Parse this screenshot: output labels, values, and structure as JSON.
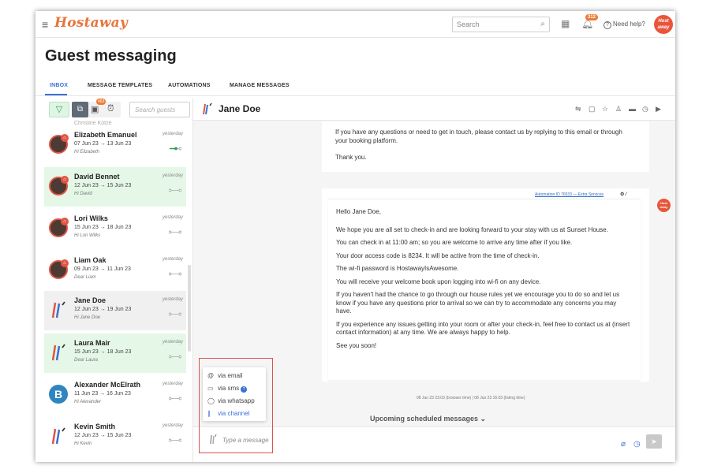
{
  "topbar": {
    "brand": "Hostaway",
    "search_placeholder": "Search",
    "notification_count": "312",
    "help_label": "Need help?",
    "user_avatar_text": "Host away"
  },
  "page": {
    "title": "Guest messaging"
  },
  "tabs": [
    {
      "label": "INBOX",
      "active": true
    },
    {
      "label": "MESSAGE TEMPLATES",
      "active": false
    },
    {
      "label": "AUTOMATIONS",
      "active": false
    },
    {
      "label": "MANAGE MESSAGES",
      "active": false
    }
  ],
  "left_panel": {
    "archive_badge": "463",
    "search_placeholder": "Search guests",
    "cut_off_text": "Christine Kotze",
    "conversations": [
      {
        "name": "Elizabeth Emanuel",
        "dates": "07 Jun 23 → 13 Jun 23",
        "message": "Hi Elizabeth",
        "when": "yesterday",
        "progress": 0.6,
        "background": "white",
        "channel": "airbnb"
      },
      {
        "name": "David Bennet",
        "dates": "12 Jun 23 → 15 Jun 23",
        "message": "Hi David",
        "when": "yesterday",
        "progress": 0,
        "background": "green",
        "channel": "airbnb"
      },
      {
        "name": "Lori Wilks",
        "dates": "15 Jun 23 → 18 Jun 23",
        "message": "Hi Lori Wilks",
        "when": "yesterday",
        "progress": 0,
        "background": "white",
        "channel": "airbnb"
      },
      {
        "name": "Liam Oak",
        "dates": "09 Jun 23 → 11 Jun 23",
        "message": "Dear Liam",
        "when": "yesterday",
        "progress": 0,
        "background": "white",
        "channel": "airbnb"
      },
      {
        "name": "Jane Doe",
        "dates": "12 Jun 23 → 19 Jun 23",
        "message": "Hi Jane Doe",
        "when": "yesterday",
        "progress": 0,
        "background": "gray",
        "channel": "hostaway"
      },
      {
        "name": "Laura Mair",
        "dates": "15 Jun 23 → 18 Jun 23",
        "message": "Dear Laura",
        "when": "yesterday",
        "progress": 0,
        "background": "green",
        "channel": "hostaway"
      },
      {
        "name": "Alexander McElrath",
        "dates": "11 Jun 23 → 16 Jun 23",
        "message": "Hi Alexander",
        "when": "yesterday",
        "progress": 0,
        "background": "white",
        "channel": "booking",
        "initial": "B"
      },
      {
        "name": "Kevin Smith",
        "dates": "12 Jun 23 → 15 Jun 23",
        "message": "Hi Kevin",
        "when": "yesterday",
        "progress": 0,
        "background": "white",
        "channel": "hostaway"
      }
    ]
  },
  "chat": {
    "guest_name": "Jane Doe",
    "message1": [
      "If you have any questions or need to get in touch, please contact us by replying to this email or through your booking platform.",
      "Thank you."
    ],
    "automation_link": "Automation ID 76533 — Extra Services",
    "message2": [
      "Hello Jane Doe,",
      "We hope you are all set to check-in and are looking forward to your stay with us at Sunset House.",
      "You can check in at 11:00 am; so you are welcome to arrive any time after if you like.",
      "Your door access code is 8234. It will be active from the time of check-in.",
      "The wi-fi password is HostawayIsAwesome.",
      "You will receive your welcome book upon logging into wi-fi on any device.",
      "If you haven't had the chance to go through our house rules yet we encourage you to do so and let us know if you have any questions prior to arrival so we can try to accommodate any concerns you may have.",
      "If you experience any issues getting into your room or after your check-in, feel free to contact us at (insert contact information) at any time. We are always happy to help.",
      "See you soon!"
    ],
    "timestamp": "08 Jun 23 23:03 (browser time) | 08 Jun 23 16:03 (listing time)",
    "upcoming_label": "Upcoming scheduled messages ⌄",
    "compose_placeholder": "Type a message",
    "host_avatar_text": "Host away"
  },
  "channel_menu": [
    {
      "label": "via email",
      "icon": "at-icon"
    },
    {
      "label": "via sms",
      "icon": "sms-icon",
      "info": "?"
    },
    {
      "label": "via whatsapp",
      "icon": "whatsapp-icon"
    },
    {
      "label": "via channel",
      "icon": "hostaway-icon",
      "highlight": true
    }
  ],
  "colors": {
    "brand_orange": "#e8753b",
    "accent_blue": "#3b6fd6",
    "row_green": "#e5f7e7",
    "row_gray": "#f0f0f0",
    "frame_red": "#d9534f"
  }
}
